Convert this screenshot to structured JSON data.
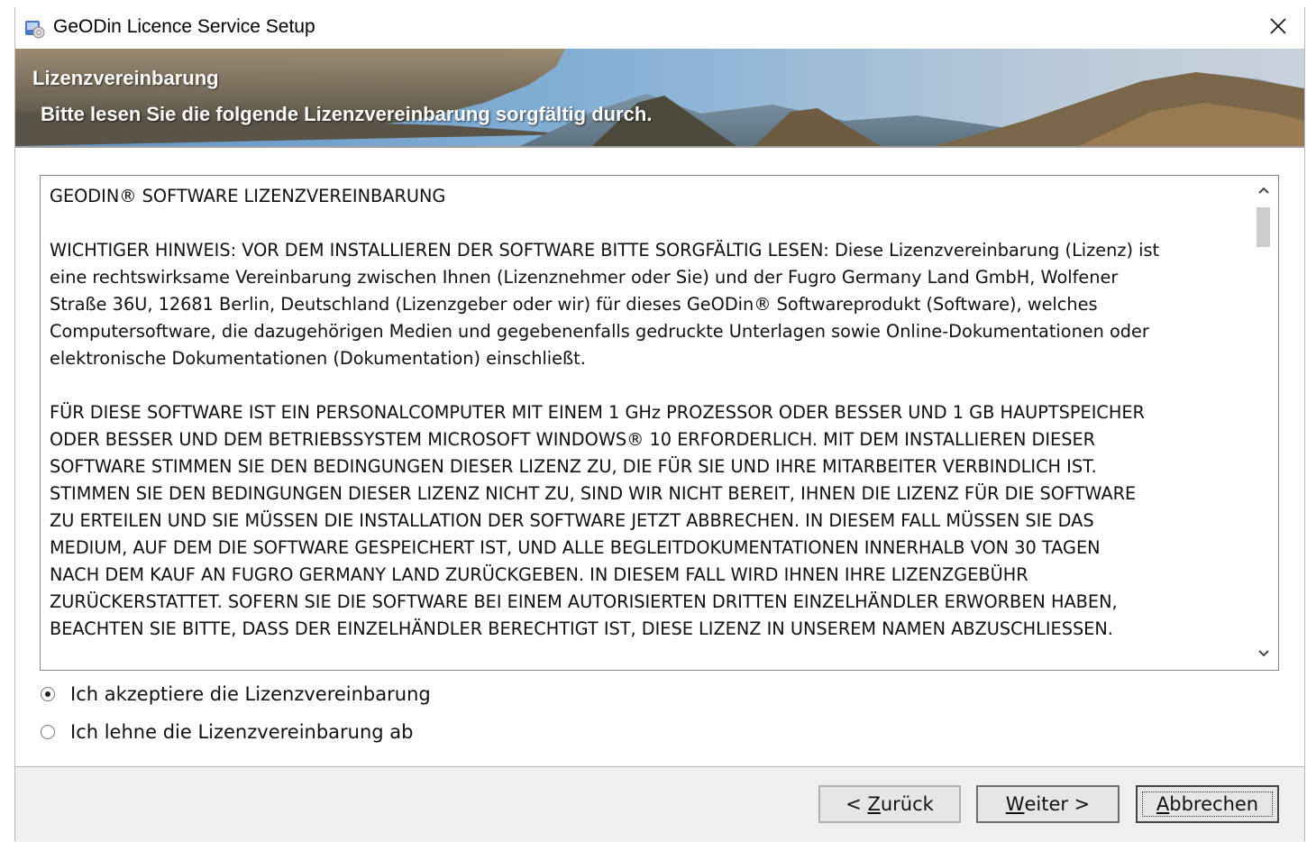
{
  "window": {
    "title": "GeODin Licence Service Setup",
    "close_glyph": "✕"
  },
  "banner": {
    "title": "Lizenzvereinbarung",
    "subtitle": "Bitte lesen Sie die folgende Lizenzvereinbarung sorgfältig durch."
  },
  "license": {
    "heading": "GEODIN® SOFTWARE LIZENZVEREINBARUNG",
    "para1_lines": [
      "WICHTIGER HINWEIS: VOR DEM INSTALLIEREN DER SOFTWARE BITTE SORGFÄLTIG LESEN: Diese Lizenzvereinbarung (Lizenz) ist",
      "eine rechtswirksame Vereinbarung zwischen Ihnen  (Lizenznehmer oder Sie) und der Fugro Germany Land GmbH, Wolfener",
      "Straße 36U, 12681 Berlin, Deutschland (Lizenzgeber oder wir) für dieses GeODin® Softwareprodukt (Software), welches",
      "Computersoftware, die dazugehörigen Medien und gegebenenfalls gedruckte Unterlagen sowie Online-Dokumentationen oder",
      "elektronische Dokumentationen (Dokumentation) einschließt."
    ],
    "para2_lines": [
      "FÜR DIESE SOFTWARE IST EIN PERSONALCOMPUTER MIT EINEM  1 GHz PROZESSOR ODER BESSER UND 1 GB HAUPTSPEICHER",
      "ODER BESSER UND DEM BETRIEBSSYSTEM MICROSOFT WINDOWS® 10 ERFORDERLICH. MIT DEM INSTALLIEREN DIESER",
      "SOFTWARE STIMMEN SIE DEN BEDINGUNGEN DIESER LIZENZ ZU, DIE FÜR SIE UND IHRE MITARBEITER VERBINDLICH IST.",
      "STIMMEN SIE DEN BEDINGUNGEN DIESER LIZENZ NICHT ZU, SIND WIR NICHT BEREIT, IHNEN DIE LIZENZ FÜR DIE SOFTWARE",
      "ZU ERTEILEN UND SIE MÜSSEN DIE INSTALLATION DER SOFTWARE JETZT ABBRECHEN. IN DIESEM FALL MÜSSEN SIE DAS",
      "MEDIUM, AUF DEM DIE SOFTWARE GESPEICHERT IST, UND ALLE BEGLEITDOKUMENTATIONEN INNERHALB VON 30 TAGEN",
      "NACH DEM KAUF AN FUGRO GERMANY LAND ZURÜCKGEBEN. IN DIESEM FALL WIRD IHNEN IHRE LIZENZGEBÜHR",
      "ZURÜCKERSTATTET. SOFERN SIE DIE SOFTWARE BEI EINEM AUTORISIERTEN DRITTEN EINZELHÄNDLER ERWORBEN HABEN,",
      "BEACHTEN SIE BITTE, DASS DER EINZELHÄNDLER BERECHTIGT IST, DIESE LIZENZ IN UNSEREM NAMEN ABZUSCHLIESSEN."
    ]
  },
  "options": {
    "accept_label": "Ich akzeptiere die Lizenzvereinbarung",
    "decline_label": "Ich lehne die Lizenzvereinbarung ab",
    "selected": "accept"
  },
  "buttons": {
    "back_prefix": "< ",
    "back_accel": "Z",
    "back_rest": "urück",
    "next_accel": "W",
    "next_rest": "eiter >",
    "cancel_accel": "A",
    "cancel_rest": "bbrechen"
  }
}
